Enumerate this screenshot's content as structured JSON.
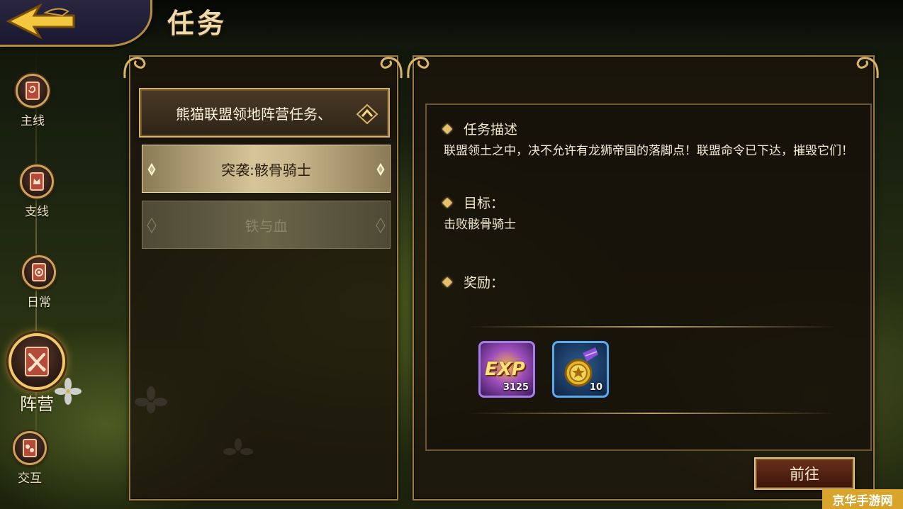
{
  "header": {
    "title": "任务"
  },
  "nav": {
    "items": [
      {
        "label": "主线",
        "icon": "scroll-swirl-icon"
      },
      {
        "label": "支线",
        "icon": "scroll-crown-icon"
      },
      {
        "label": "日常",
        "icon": "scroll-spiral-icon"
      },
      {
        "label": "阵营",
        "icon": "crossed-swords-icon",
        "active": true
      },
      {
        "label": "交互",
        "icon": "scroll-faces-icon"
      }
    ]
  },
  "quest_list": {
    "group_title": "熊猫联盟领地阵营任务、",
    "items": [
      {
        "label": "突袭:骸骨骑士",
        "selected": true
      },
      {
        "label": "铁与血",
        "selected": false
      }
    ]
  },
  "details": {
    "description_heading": "任务描述",
    "description_text": "联盟领土之中，决不允许有龙狮帝国的落脚点！联盟命令已下达，摧毁它们！",
    "target_heading": "目标：",
    "target_text": "击败骸骨骑士",
    "reward_heading": "奖励：",
    "rewards": [
      {
        "name": "EXP",
        "count": "3125",
        "icon": "exp-icon",
        "border_color": "#a680e0"
      },
      {
        "name": "medal",
        "count": "10",
        "icon": "gold-medal-icon",
        "border_color": "#5fa9e8"
      }
    ]
  },
  "actions": {
    "go_label": "前往"
  },
  "watermark": {
    "text": "京华手游网"
  },
  "colors": {
    "gold_border": "#d6b36c",
    "panel_bg": "#1c140c",
    "selected_item": "#d7c59a"
  }
}
